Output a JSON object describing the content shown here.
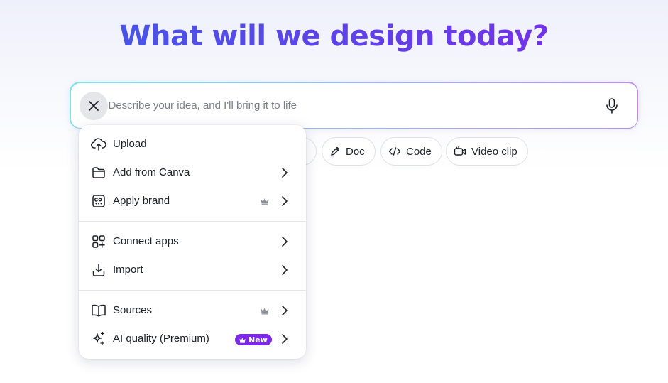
{
  "headline": "What will we design today?",
  "prompt": {
    "placeholder": "Describe your idea, and I'll bring it to life",
    "value": ""
  },
  "chips": [
    {
      "label": "Doc",
      "icon": "doc-pen-icon"
    },
    {
      "label": "Code",
      "icon": "code-icon"
    },
    {
      "label": "Video clip",
      "icon": "video-clip-icon"
    }
  ],
  "menu": {
    "items": [
      {
        "label": "Upload",
        "icon": "cloud-upload-icon",
        "crown": false,
        "chevron": false
      },
      {
        "label": "Add from Canva",
        "icon": "folder-icon",
        "crown": false,
        "chevron": true
      },
      {
        "label": "Apply brand",
        "icon": "brand-kit-icon",
        "crown": true,
        "chevron": true
      },
      {
        "label": "Connect apps",
        "icon": "apps-grid-plus-icon",
        "crown": false,
        "chevron": true
      },
      {
        "label": "Import",
        "icon": "import-download-icon",
        "crown": false,
        "chevron": true
      },
      {
        "label": "Sources",
        "icon": "book-icon",
        "crown": true,
        "chevron": true
      },
      {
        "label": "AI quality (Premium)",
        "icon": "sparkles-icon",
        "crown": false,
        "chevron": true,
        "badge": "New"
      }
    ]
  },
  "colors": {
    "accent_purple": "#7d2ae8",
    "accent_blue": "#3d5ee6",
    "border_cyan": "#7fe3ea"
  }
}
